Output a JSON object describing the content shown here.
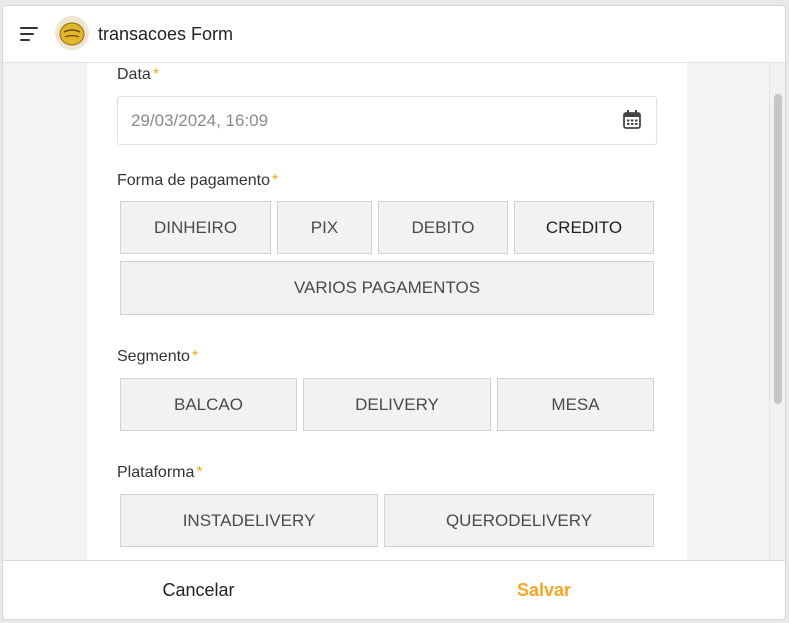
{
  "header": {
    "title": "transacoes Form",
    "menu_icon": "hamburger-menu-icon",
    "logo_icon": "app-logo"
  },
  "fields": {
    "data": {
      "label": "Data",
      "required_mark": "*",
      "value": "29/03/2024, 16:09",
      "icon": "calendar-icon"
    },
    "forma_pagamento": {
      "label": "Forma de pagamento",
      "required_mark": "*",
      "options": [
        "DINHEIRO",
        "PIX",
        "DEBITO",
        "CREDITO",
        "VARIOS PAGAMENTOS"
      ]
    },
    "segmento": {
      "label": "Segmento",
      "required_mark": "*",
      "options": [
        "BALCAO",
        "DELIVERY",
        "MESA"
      ]
    },
    "plataforma": {
      "label": "Plataforma",
      "required_mark": "*",
      "options": [
        "INSTADELIVERY",
        "QUERODELIVERY"
      ]
    }
  },
  "footer": {
    "cancel_label": "Cancelar",
    "save_label": "Salvar"
  },
  "colors": {
    "accent": "#f5a623",
    "button_bg": "#f2f2f2",
    "border": "#d2d2d2"
  }
}
